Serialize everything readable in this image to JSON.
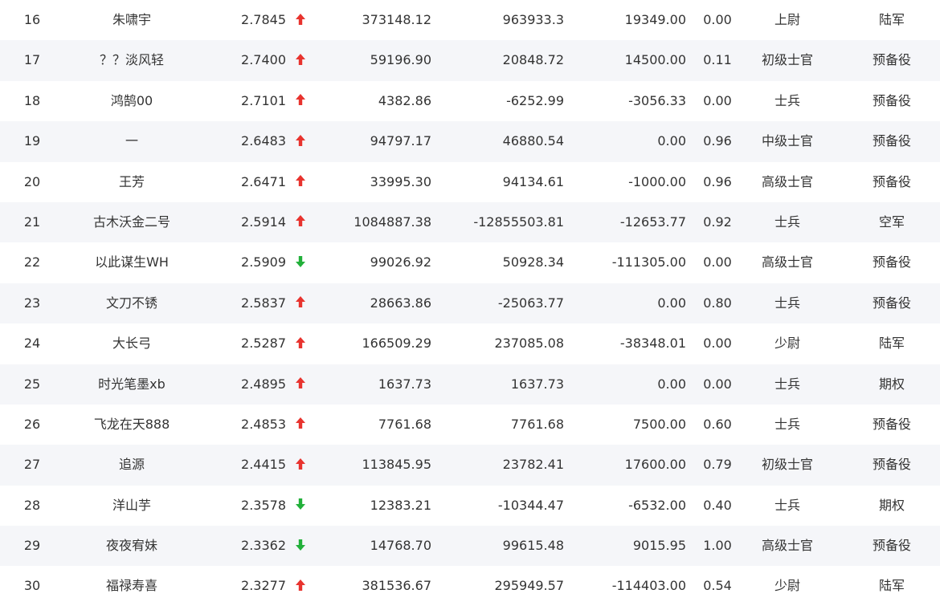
{
  "rows": [
    {
      "rank": "16",
      "name": "朱啸宇",
      "score": "2.7845",
      "trend": "up",
      "v1": "373148.12",
      "v2": "963933.3",
      "v3": "19349.00",
      "ratio": "0.00",
      "rank_title": "上尉",
      "unit": "陆军"
    },
    {
      "rank": "17",
      "name": "？？淡风轻",
      "score": "2.7400",
      "trend": "up",
      "v1": "59196.90",
      "v2": "20848.72",
      "v3": "14500.00",
      "ratio": "0.11",
      "rank_title": "初级士官",
      "unit": "预备役"
    },
    {
      "rank": "18",
      "name": "鸿鹄00",
      "score": "2.7101",
      "trend": "up",
      "v1": "4382.86",
      "v2": "-6252.99",
      "v3": "-3056.33",
      "ratio": "0.00",
      "rank_title": "士兵",
      "unit": "预备役"
    },
    {
      "rank": "19",
      "name": "一",
      "score": "2.6483",
      "trend": "up",
      "v1": "94797.17",
      "v2": "46880.54",
      "v3": "0.00",
      "ratio": "0.96",
      "rank_title": "中级士官",
      "unit": "预备役"
    },
    {
      "rank": "20",
      "name": "王芳",
      "score": "2.6471",
      "trend": "up",
      "v1": "33995.30",
      "v2": "94134.61",
      "v3": "-1000.00",
      "ratio": "0.96",
      "rank_title": "高级士官",
      "unit": "预备役"
    },
    {
      "rank": "21",
      "name": "古木沃金二号",
      "score": "2.5914",
      "trend": "up",
      "v1": "1084887.38",
      "v2": "-12855503.81",
      "v3": "-12653.77",
      "ratio": "0.92",
      "rank_title": "士兵",
      "unit": "空军"
    },
    {
      "rank": "22",
      "name": "以此谋生WH",
      "score": "2.5909",
      "trend": "down",
      "v1": "99026.92",
      "v2": "50928.34",
      "v3": "-111305.00",
      "ratio": "0.00",
      "rank_title": "高级士官",
      "unit": "预备役"
    },
    {
      "rank": "23",
      "name": "文刀不锈",
      "score": "2.5837",
      "trend": "up",
      "v1": "28663.86",
      "v2": "-25063.77",
      "v3": "0.00",
      "ratio": "0.80",
      "rank_title": "士兵",
      "unit": "预备役"
    },
    {
      "rank": "24",
      "name": "大长弓",
      "score": "2.5287",
      "trend": "up",
      "v1": "166509.29",
      "v2": "237085.08",
      "v3": "-38348.01",
      "ratio": "0.00",
      "rank_title": "少尉",
      "unit": "陆军"
    },
    {
      "rank": "25",
      "name": "时光笔墨xb",
      "score": "2.4895",
      "trend": "up",
      "v1": "1637.73",
      "v2": "1637.73",
      "v3": "0.00",
      "ratio": "0.00",
      "rank_title": "士兵",
      "unit": "期权"
    },
    {
      "rank": "26",
      "name": "飞龙在天888",
      "score": "2.4853",
      "trend": "up",
      "v1": "7761.68",
      "v2": "7761.68",
      "v3": "7500.00",
      "ratio": "0.60",
      "rank_title": "士兵",
      "unit": "预备役"
    },
    {
      "rank": "27",
      "name": "追源",
      "score": "2.4415",
      "trend": "up",
      "v1": "113845.95",
      "v2": "23782.41",
      "v3": "17600.00",
      "ratio": "0.79",
      "rank_title": "初级士官",
      "unit": "预备役"
    },
    {
      "rank": "28",
      "name": "洋山芋",
      "score": "2.3578",
      "trend": "down",
      "v1": "12383.21",
      "v2": "-10344.47",
      "v3": "-6532.00",
      "ratio": "0.40",
      "rank_title": "士兵",
      "unit": "期权"
    },
    {
      "rank": "29",
      "name": "夜夜宥妹",
      "score": "2.3362",
      "trend": "down",
      "v1": "14768.70",
      "v2": "99615.48",
      "v3": "9015.95",
      "ratio": "1.00",
      "rank_title": "高级士官",
      "unit": "预备役"
    },
    {
      "rank": "30",
      "name": "福禄寿喜",
      "score": "2.3277",
      "trend": "up",
      "v1": "381536.67",
      "v2": "295949.57",
      "v3": "-114403.00",
      "ratio": "0.54",
      "rank_title": "少尉",
      "unit": "陆军"
    }
  ],
  "colors": {
    "up_arrow": "#e8332e",
    "down_arrow": "#22b03a",
    "alt_row_bg": "#f5f6f9",
    "text": "#333333"
  },
  "icons": {
    "up": "arrow-up-icon",
    "down": "arrow-down-icon"
  }
}
